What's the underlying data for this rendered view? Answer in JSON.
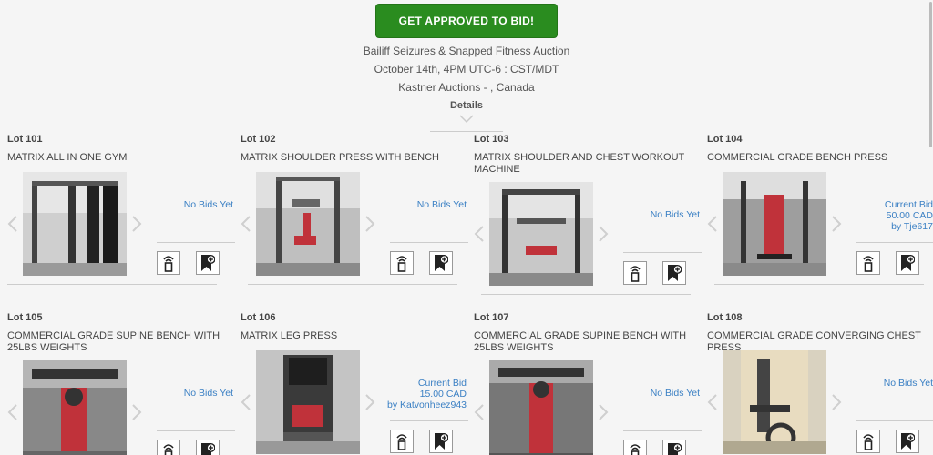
{
  "header": {
    "approve_button": "GET APPROVED TO BID!",
    "auction_title": "Bailiff Seizures & Snapped Fitness Auction",
    "auction_date": "October 14th, 4PM UTC-6 : CST/MDT",
    "auction_location": "Kastner Auctions - , Canada",
    "details_label": "Details"
  },
  "lots": [
    {
      "lot": "Lot 101",
      "title": "MATRIX ALL IN ONE GYM",
      "bid_lines": [
        "No Bids Yet"
      ]
    },
    {
      "lot": "Lot 102",
      "title": "MATRIX SHOULDER PRESS WITH BENCH",
      "bid_lines": [
        "No Bids Yet"
      ]
    },
    {
      "lot": "Lot 103",
      "title": "MATRIX SHOULDER AND CHEST WORKOUT MACHINE",
      "bid_lines": [
        "No Bids Yet"
      ]
    },
    {
      "lot": "Lot 104",
      "title": "COMMERCIAL GRADE BENCH PRESS",
      "bid_lines": [
        "Current Bid",
        "50.00 CAD",
        "by Tje617"
      ]
    },
    {
      "lot": "Lot 105",
      "title": "COMMERCIAL GRADE SUPINE BENCH WITH 25LBS WEIGHTS",
      "bid_lines": [
        "No Bids Yet"
      ]
    },
    {
      "lot": "Lot 106",
      "title": "MATRIX LEG PRESS",
      "bid_lines": [
        "Current Bid",
        "15.00 CAD",
        "by Katvonheez943"
      ]
    },
    {
      "lot": "Lot 107",
      "title": "COMMERCIAL GRADE SUPINE BENCH WITH 25LBS WEIGHTS",
      "bid_lines": [
        "No Bids Yet"
      ]
    },
    {
      "lot": "Lot 108",
      "title": "COMMERCIAL GRADE CONVERGING CHEST PRESS",
      "bid_lines": [
        "No Bids Yet"
      ]
    }
  ],
  "colors": {
    "accent_green": "#2a8c1f",
    "link_blue": "#3b80c4",
    "background": "#f5f5f5"
  },
  "icons": {
    "bid": "bid-paddle-icon",
    "watch": "bookmark-add-icon",
    "prev": "chevron-left-icon",
    "next": "chevron-right-icon"
  }
}
